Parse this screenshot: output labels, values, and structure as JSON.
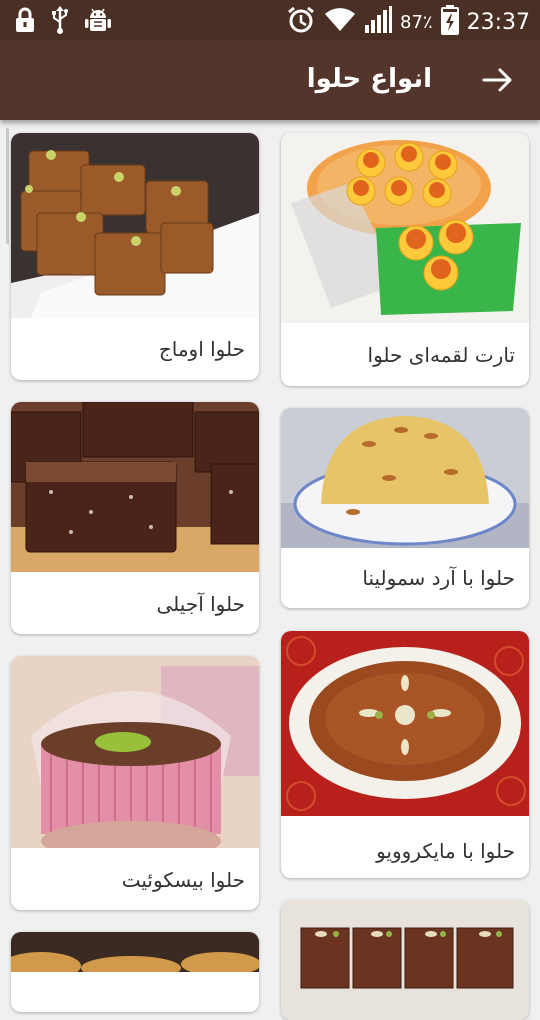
{
  "status_bar": {
    "battery_percent": "87٪",
    "time": "23:37",
    "icons": [
      "lock-icon",
      "usb-icon",
      "android-debug-icon",
      "alarm-icon",
      "wifi-icon",
      "signal-icon",
      "battery-charging-icon"
    ]
  },
  "app_bar": {
    "title": "انواع حلوا",
    "back_icon": "arrow-right-icon"
  },
  "colors": {
    "status_bar": "#4a2f25",
    "app_bar": "#54352b",
    "background": "#f0f0f0",
    "card": "#ffffff"
  },
  "recipes": [
    {
      "label": "تارت لقمه‌ای حلوا",
      "image": "halva-tarts-photo"
    },
    {
      "label": "حلوا اوماج",
      "image": "omaj-halva-squares-photo"
    },
    {
      "label": "حلوا با آرد سمولینا",
      "image": "semolina-halva-dome-photo"
    },
    {
      "label": "حلوا آجیلی",
      "image": "nut-halva-bars-photo"
    },
    {
      "label": "حلوا با مایکروویو",
      "image": "microwave-halva-plate-photo"
    },
    {
      "label": "حلوا بیسکوئیت",
      "image": "biscuit-halva-cup-photo"
    },
    {
      "label": "",
      "image": "halva-partial-photo"
    },
    {
      "label": "",
      "image": "halva-partial-photo"
    }
  ]
}
